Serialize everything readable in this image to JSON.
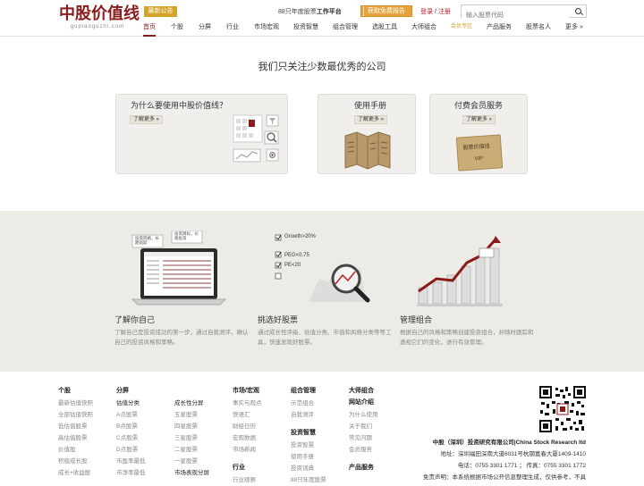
{
  "header": {
    "logo_text": "中股价值线",
    "logo_sub": "gupiaoguzhi.com",
    "notice_label": "最新公告",
    "promo_prefix": "88只年度股票",
    "promo_bold": "工作平台",
    "trial_label": "获取免费报告",
    "login_label": "登录",
    "login_sep": "/",
    "register_label": "注册",
    "search_placeholder": "输入股票代码"
  },
  "nav": {
    "items": [
      {
        "label": "首页"
      },
      {
        "label": "个股"
      },
      {
        "label": "分屏"
      },
      {
        "label": "行业"
      },
      {
        "label": "市场宏观"
      },
      {
        "label": "投资智慧"
      },
      {
        "label": "组合管理"
      },
      {
        "label": "选股工具"
      },
      {
        "label": "大师组合"
      },
      {
        "label": "会员专区"
      },
      {
        "label": "产品服务"
      },
      {
        "label": "股票名人"
      },
      {
        "label": "更多 »"
      }
    ]
  },
  "hero": {
    "title": "我们只关注少数最优秀的公司"
  },
  "cards": [
    {
      "title": "为什么要使用中股价值线？",
      "more": "了解更多 »"
    },
    {
      "title": "使用手册",
      "more": "了解更多 »"
    },
    {
      "title": "付费会员服务",
      "more": "了解更多 »",
      "vip_card_text": "股票价值线",
      "vip_label": "VIP"
    }
  ],
  "features": [
    {
      "title": "了解你自己",
      "desc": "了解自己是投资成功的第一步，通过自我测评，确认自己的投资风格和策略。",
      "bubble1": "投资风格，长期追踪",
      "bubble2": "投资目标，价值投资"
    },
    {
      "title": "挑选好股票",
      "desc": "通过成长性评级、估值分类、市值和风格分类等等工具，快速发现好股票。",
      "checks": [
        "Growth>20%",
        "PEG<0.75",
        "PE<20"
      ]
    },
    {
      "title": "管理组合",
      "desc": "根据自己的风格和策略创建投资组合，并随时跟踪和透视它们的变化，进行有效管理。"
    }
  ],
  "footer": {
    "columns": [
      {
        "head": "个股",
        "items": [
          "最新估值快照",
          "全部估值快照",
          "低估值股票",
          "高估值股票",
          "价值股",
          "积极成长股",
          "成长+收益股"
        ]
      },
      {
        "head": "分屏",
        "items": [
          "估值分类",
          "A点股票",
          "B点股票",
          "C点股票",
          "D点股票",
          "市盈率最低",
          "市净率最低"
        ],
        "bold_index": [
          0
        ]
      },
      {
        "head": "",
        "items": [
          "成长性分屏",
          "五星股票",
          "四星股票",
          "三星股票",
          "二星股票",
          "一星股票",
          "市场表现分屏"
        ],
        "bold_index": [
          0,
          6
        ]
      },
      {
        "head": "市场/宏观",
        "items": [
          "事实与观点",
          "快语汇",
          "财经日历",
          "宏观数据",
          "市场新闻",
          "",
          "行业",
          "行业观察"
        ],
        "bold_index": [
          6
        ]
      },
      {
        "head": "组合管理",
        "items": [
          "示范组合",
          "自我测评",
          "",
          "投资智慧",
          "投资智慧",
          "使用手册",
          "投资词典",
          "88只年度股票"
        ],
        "bold_index": [
          3
        ]
      },
      {
        "head": "大师组合",
        "items": [
          "网站介绍",
          "为什么使用",
          "关于我们",
          "常见问题",
          "会员服务",
          "",
          "产品服务"
        ],
        "bold_index": [
          0,
          6
        ]
      }
    ],
    "company": "中股（深圳）投资研究有限公司|China Stock Research ltd",
    "address": "地址：深圳福田深南大道6031号杭钢富春大厦1409-1410",
    "phone": "电话：0755 3301 1771 ； 传真：0755 3301 1772",
    "disclaimer": "免责声明：本系统根据市场公开信息整理生成，仅供参考，不具"
  }
}
